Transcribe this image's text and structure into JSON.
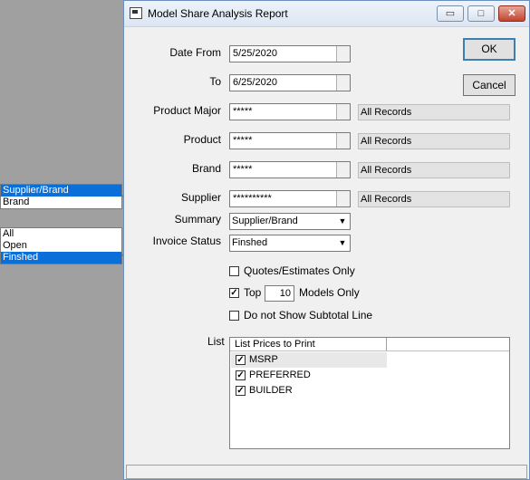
{
  "callouts": {
    "summary_options": [
      "Supplier/Brand",
      "Brand"
    ],
    "summary_selected": 0,
    "status_options": [
      "All",
      "Open",
      "Finshed"
    ],
    "status_selected": 2,
    "arrow_color": "#4a7cc7"
  },
  "window": {
    "title": "Model Share Analysis Report",
    "minimize_glyph": "▭",
    "maximize_glyph": "□",
    "close_glyph": "✕"
  },
  "form": {
    "date_from_label": "Date From",
    "date_from_value": "5/25/2020",
    "to_label": "To",
    "to_value": "6/25/2020",
    "product_major_label": "Product Major",
    "product_major_value": "*****",
    "product_major_desc": "All Records",
    "product_label": "Product",
    "product_value": "*****",
    "product_desc": "All Records",
    "brand_label": "Brand",
    "brand_value": "*****",
    "brand_desc": "All Records",
    "supplier_label": "Supplier",
    "supplier_value": "**********",
    "supplier_desc": "All Records",
    "summary_label": "Summary",
    "summary_value": "Supplier/Brand",
    "invoice_status_label": "Invoice Status",
    "invoice_status_value": "Finshed"
  },
  "buttons": {
    "ok": "OK",
    "cancel": "Cancel"
  },
  "options": {
    "quotes_label": "Quotes/Estimates Only",
    "quotes_checked": false,
    "top_label": "Top",
    "top_checked": true,
    "top_value": "10",
    "models_only_label": "Models Only",
    "subtotal_label": "Do not Show Subtotal Line",
    "subtotal_checked": false
  },
  "list": {
    "label": "List",
    "header": "List Prices to Print",
    "items": [
      {
        "label": "MSRP",
        "checked": true
      },
      {
        "label": "PREFERRED",
        "checked": true
      },
      {
        "label": "BUILDER",
        "checked": true
      }
    ]
  },
  "check_glyph": "✓",
  "dropdown_glyph": "▼"
}
